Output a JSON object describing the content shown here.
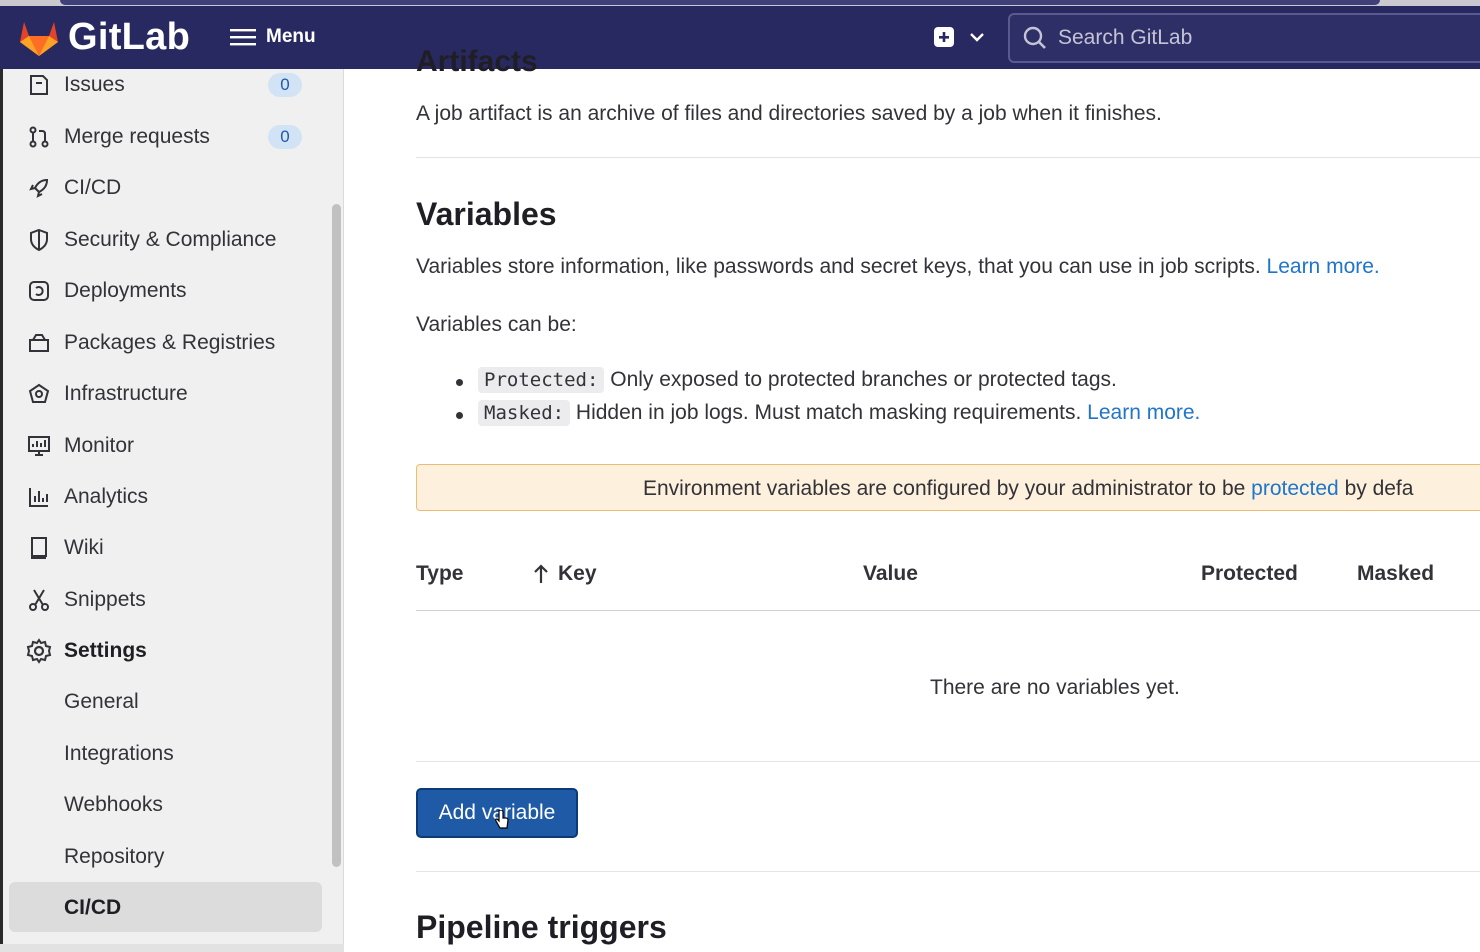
{
  "topbar": {
    "brand": "GitLab",
    "menu_label": "Menu",
    "search_placeholder": "Search GitLab"
  },
  "sidebar": {
    "items": [
      {
        "label": "Issues",
        "badge": "0"
      },
      {
        "label": "Merge requests",
        "badge": "0"
      },
      {
        "label": "CI/CD"
      },
      {
        "label": "Security & Compliance"
      },
      {
        "label": "Deployments"
      },
      {
        "label": "Packages & Registries"
      },
      {
        "label": "Infrastructure"
      },
      {
        "label": "Monitor"
      },
      {
        "label": "Analytics"
      },
      {
        "label": "Wiki"
      },
      {
        "label": "Snippets"
      },
      {
        "label": "Settings"
      }
    ],
    "settings_sub": [
      "General",
      "Integrations",
      "Webhooks",
      "Repository",
      "CI/CD"
    ],
    "active_sub": "CI/CD"
  },
  "artifacts": {
    "heading": "Artifacts",
    "description": "A job artifact is an archive of files and directories saved by a job when it finishes."
  },
  "variables": {
    "heading": "Variables",
    "description": "Variables store information, like passwords and secret keys, that you can use in job scripts.",
    "learn_more": "Learn more.",
    "can_be": "Variables can be:",
    "protected_code": "Protected:",
    "protected_text": "Only exposed to protected branches or protected tags.",
    "masked_code": "Masked:",
    "masked_text": "Hidden in job logs. Must match masking requirements.",
    "masked_learn_more": "Learn more.",
    "alert_prefix": "Environment variables are configured by your administrator to be",
    "alert_link": "protected",
    "alert_suffix": "by defa",
    "table_headers": {
      "type": "Type",
      "key": "Key",
      "value": "Value",
      "protected": "Protected",
      "masked": "Masked"
    },
    "empty_text": "There are no variables yet.",
    "add_button": "Add variable"
  },
  "pipeline_triggers": {
    "heading": "Pipeline triggers"
  },
  "colors": {
    "topbar": "#292961",
    "link": "#1f75cb",
    "button": "#1f5aa7",
    "alert_bg": "#fdf1dd",
    "badge_bg": "#d2e3f6"
  }
}
